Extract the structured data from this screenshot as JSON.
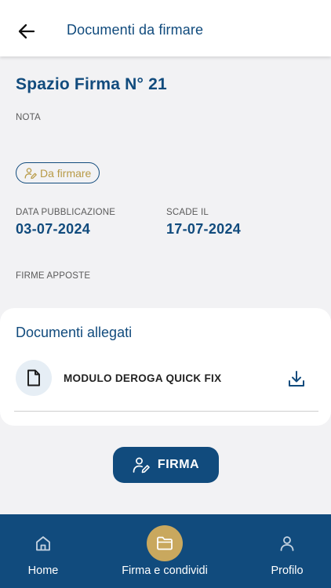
{
  "header": {
    "title": "Documenti da firmare",
    "back_icon": "arrow-left-icon"
  },
  "detail": {
    "space_title": "Spazio Firma N° 21",
    "note_label": "NOTA",
    "note_value": "",
    "status": {
      "label": "Da firmare",
      "icon": "sign-pen-icon",
      "color": "#b89a46"
    },
    "publication_label": "DATA PUBBLICAZIONE",
    "publication_date": "03-07-2024",
    "expiry_label": "SCADE IL",
    "expiry_date": "17-07-2024",
    "signatures_label": "FIRME APPOSTE",
    "signatures_value": ""
  },
  "attachments": {
    "title": "Documenti allegati",
    "items": [
      {
        "name": "MODULO DEROGA QUICK FIX",
        "icon": "document-icon",
        "action_icon": "download-icon"
      }
    ]
  },
  "sign_button": {
    "label": "FIRMA",
    "icon": "sign-pen-icon"
  },
  "bottom_nav": {
    "items": [
      {
        "label": "Home",
        "icon": "home-icon",
        "active": false
      },
      {
        "label": "Firma e condividi",
        "icon": "folder-icon",
        "active": true
      },
      {
        "label": "Profilo",
        "icon": "user-icon",
        "active": false
      }
    ]
  },
  "colors": {
    "primary": "#114b7d",
    "accent": "#c9a85e",
    "background": "#f2f2f4"
  }
}
